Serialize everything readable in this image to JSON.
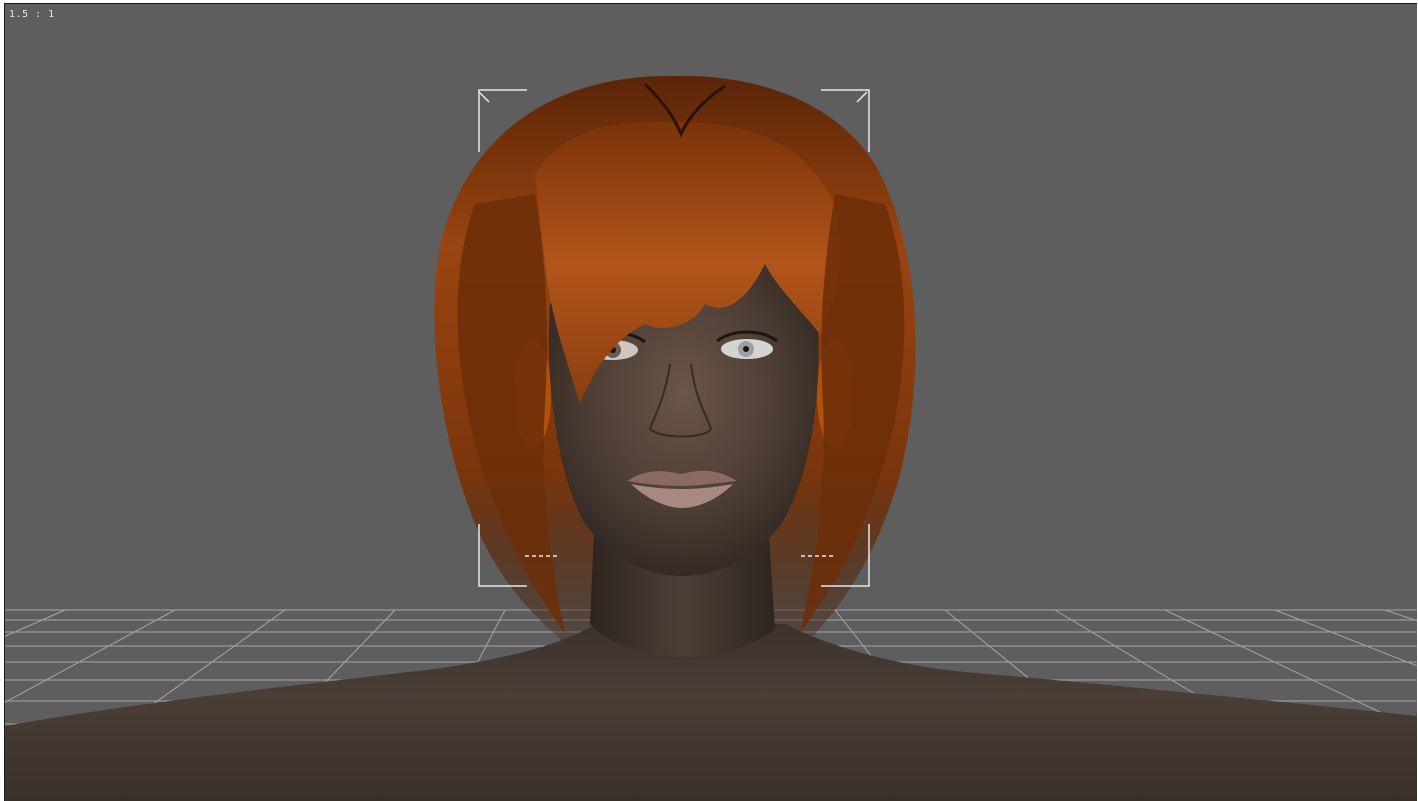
{
  "viewport": {
    "aspect_label": "1.5 : 1",
    "background": "#5e5e5e",
    "grid_color": "#bdbdbd"
  },
  "scene": {
    "figure": "female-3d-figure",
    "hair_color": "#8a3a0a",
    "skin_color": "#4e3f36"
  },
  "icons": {
    "frame_corners": "camera-frame-corner-icon"
  }
}
